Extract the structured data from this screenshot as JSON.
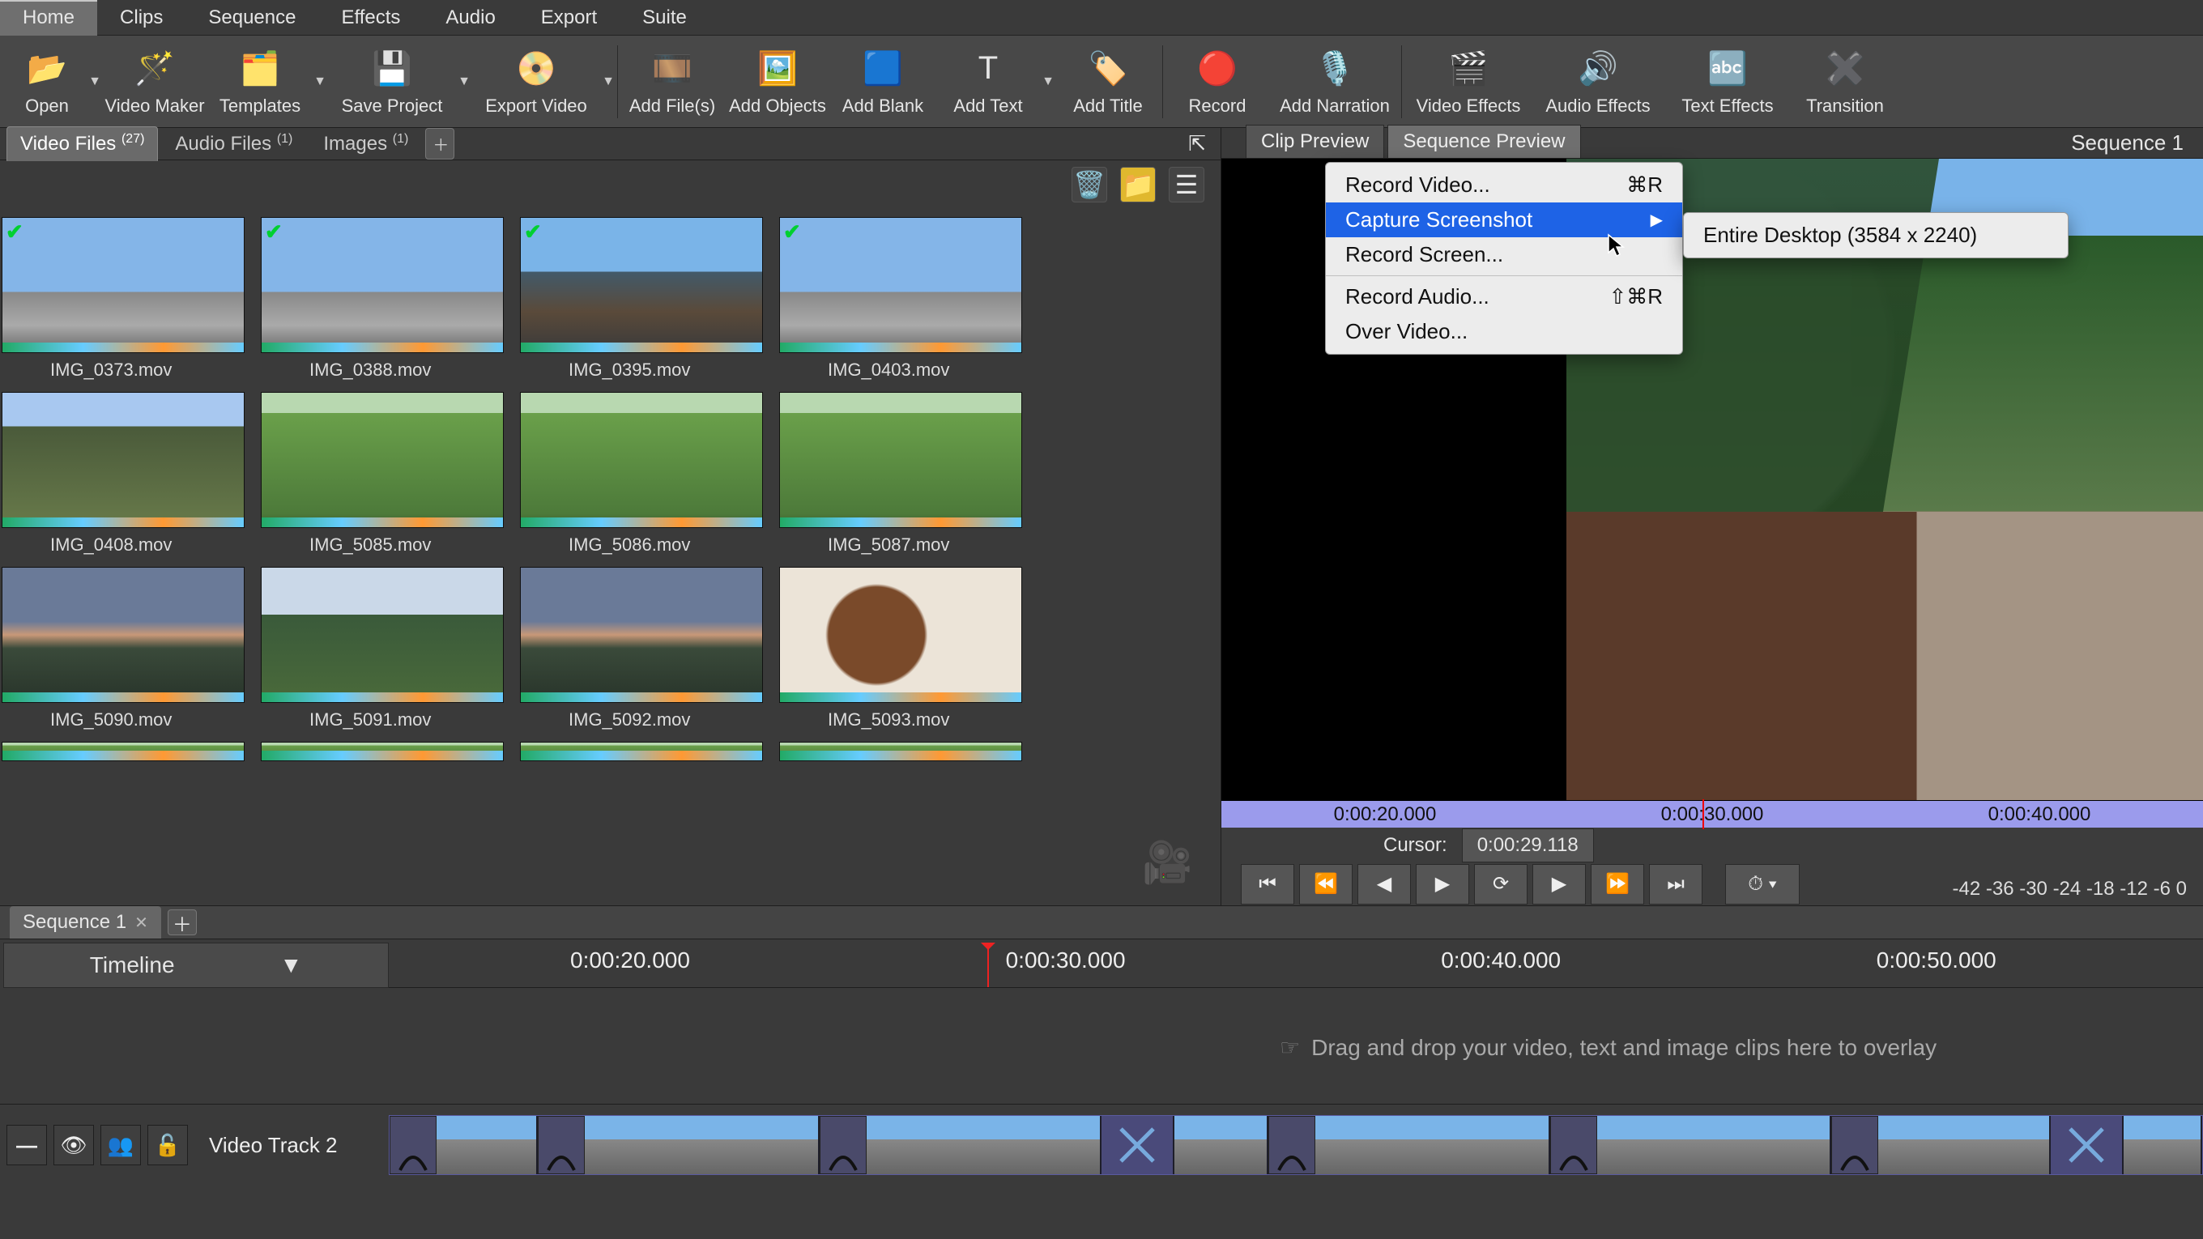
{
  "menubar": [
    "Home",
    "Clips",
    "Sequence",
    "Effects",
    "Audio",
    "Export",
    "Suite"
  ],
  "active_menu": 0,
  "toolbar": [
    {
      "label": "Open",
      "icon": "📂",
      "dd": true
    },
    {
      "label": "Video Maker",
      "icon": "🪄"
    },
    {
      "label": "Templates",
      "icon": "🗂️",
      "dd": true
    },
    {
      "label": "Save Project",
      "icon": "💾",
      "dd": true
    },
    {
      "label": "Export Video",
      "icon": "📀",
      "dd": true
    },
    {
      "sep": true
    },
    {
      "label": "Add File(s)",
      "icon": "🎞️"
    },
    {
      "label": "Add Objects",
      "icon": "🖼️"
    },
    {
      "label": "Add Blank",
      "icon": "🟦"
    },
    {
      "label": "Add Text",
      "icon": "T",
      "dd": true
    },
    {
      "label": "Add Title",
      "icon": "🏷️"
    },
    {
      "sep": true
    },
    {
      "label": "Record",
      "icon": "🔴"
    },
    {
      "label": "Add Narration",
      "icon": "🎙️"
    },
    {
      "sep": true
    },
    {
      "label": "Video Effects",
      "icon": "🎬"
    },
    {
      "label": "Audio Effects",
      "icon": "🔊"
    },
    {
      "label": "Text Effects",
      "icon": "🔤"
    },
    {
      "label": "Transition",
      "icon": "✖️"
    }
  ],
  "file_tabs": [
    {
      "label": "Video Files",
      "count": "(27)",
      "active": true
    },
    {
      "label": "Audio Files",
      "count": "(1)"
    },
    {
      "label": "Images",
      "count": "(1)"
    }
  ],
  "clips": [
    [
      {
        "name": "IMG_0373.mov",
        "cls": "sky",
        "check": true
      },
      {
        "name": "IMG_0388.mov",
        "cls": "sky",
        "check": true
      },
      {
        "name": "IMG_0395.mov",
        "cls": "marina",
        "check": true
      },
      {
        "name": "IMG_0403.mov",
        "cls": "sky",
        "check": true
      }
    ],
    [
      {
        "name": "IMG_0408.mov",
        "cls": "field"
      },
      {
        "name": "IMG_5085.mov",
        "cls": "grass"
      },
      {
        "name": "IMG_5086.mov",
        "cls": "grass"
      },
      {
        "name": "IMG_5087.mov",
        "cls": "grass"
      }
    ],
    [
      {
        "name": "IMG_5090.mov",
        "cls": "dusk"
      },
      {
        "name": "IMG_5091.mov",
        "cls": "horse"
      },
      {
        "name": "IMG_5092.mov",
        "cls": "dusk"
      },
      {
        "name": "IMG_5093.mov",
        "cls": "cow"
      }
    ]
  ],
  "preview": {
    "tabs": [
      "Clip Preview",
      "Sequence Preview"
    ],
    "active_tab": 1,
    "sequence_title": "Sequence 1",
    "timebar": [
      "0:00:20.000",
      "0:00:30.000",
      "0:00:40.000"
    ],
    "cursor_label": "Cursor:",
    "cursor_value": "0:00:29.118",
    "meter": "-42 -36 -30 -24 -18 -12  -6   0"
  },
  "context_menu": {
    "items": [
      {
        "label": "Record Video...",
        "accel": "⌘R"
      },
      {
        "label": "Capture Screenshot",
        "submenu": true,
        "selected": true
      },
      {
        "label": "Record Screen..."
      },
      {
        "sep": true
      },
      {
        "label": "Record Audio...",
        "accel": "⇧⌘R"
      },
      {
        "label": "Over Video..."
      }
    ],
    "submenu": [
      {
        "label": "Entire Desktop (3584 x 2240)"
      }
    ]
  },
  "sequence": {
    "tab": "Sequence 1",
    "timeline_button": "Timeline",
    "ruler": [
      "0:00:20.000",
      "0:00:30.000",
      "0:00:40.000",
      "0:00:50.000"
    ],
    "overlay_hint": "Drag and drop your video, text and image clips here to overlay",
    "track_name": "Video Track 2"
  }
}
